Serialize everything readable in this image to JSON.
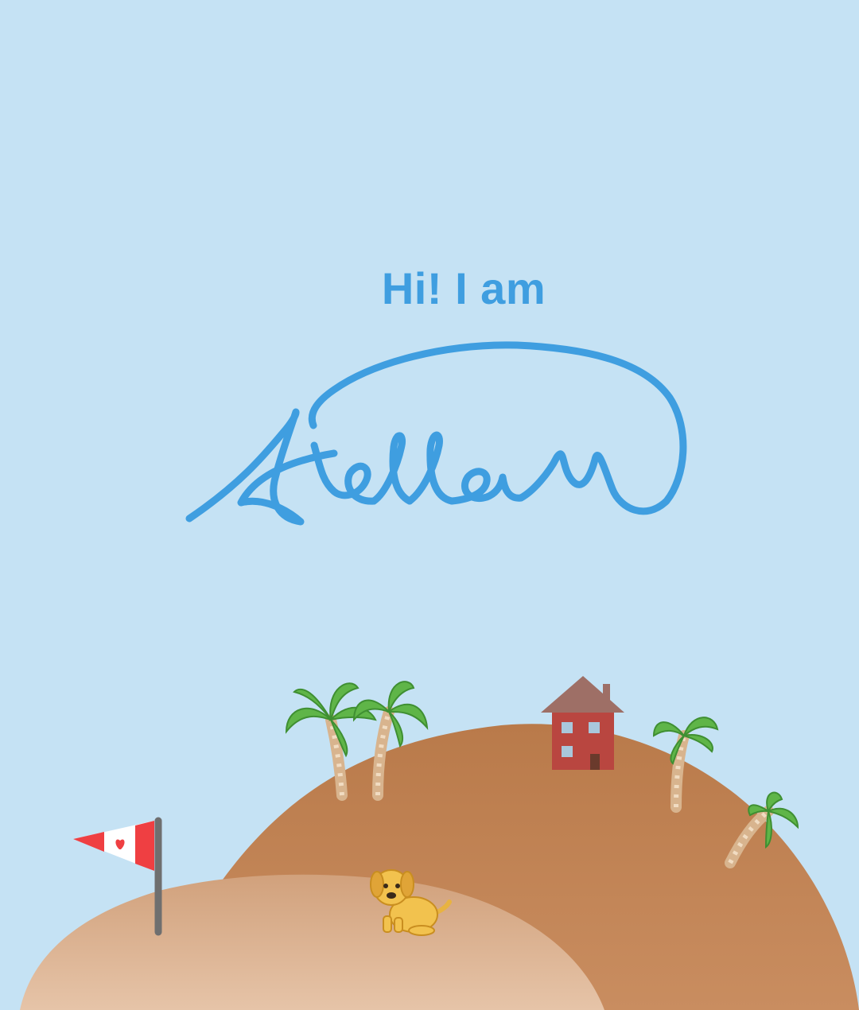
{
  "greeting": "Hi! I am",
  "signature_name": "Stella",
  "colors": {
    "sky": "#c5e2f4",
    "accent": "#3f9ee0",
    "hill_back": "#c08252",
    "hill_front": "#d9b190",
    "house_wall": "#b94640",
    "house_roof": "#9e6f66",
    "flag_red": "#ef3f42"
  },
  "scene_items": {
    "flag": "canada-flag-icon",
    "dog": "dog-icon",
    "house": "house-icon",
    "palm": "palm-tree-icon"
  }
}
